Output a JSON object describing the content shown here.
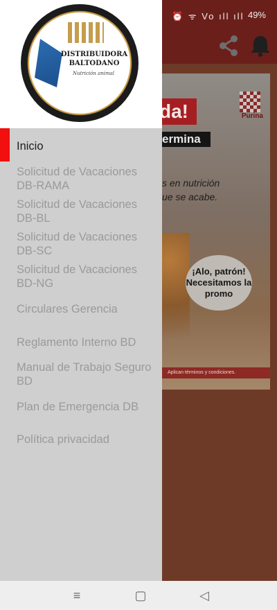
{
  "status_bar": {
    "icons": "⏰ ᯤ Vo ıll ıll",
    "battery": "49%"
  },
  "ad": {
    "headline_fragment": "da!",
    "black_banner": "ermina",
    "brand": "Purina",
    "line1": "s en nutrición",
    "line2": "ue se acabe.",
    "bubble": "¡Alo, patrón! Necesitamos la promo",
    "footer": "Aplican términos y condiciones."
  },
  "logo": {
    "title": "DISTRIBUIDORA BALTODANO",
    "subtitle": "Nutrición animal"
  },
  "menu": {
    "items": [
      {
        "label": "Inicio",
        "active": true
      },
      {
        "label": "Solicitud de Vacaciones DB-RAMA",
        "active": false
      },
      {
        "label": "Solicitud de Vacaciones DB-BL",
        "active": false
      },
      {
        "label": "Solicitud de Vacaciones DB-SC",
        "active": false
      },
      {
        "label": "Solicitud de Vacaciones BD-NG",
        "active": false
      },
      {
        "label": "Circulares Gerencia",
        "active": false
      },
      {
        "label": "Reglamento Interno BD",
        "active": false
      },
      {
        "label": "Manual de Trabajo Seguro BD",
        "active": false
      },
      {
        "label": "Plan de Emergencia DB",
        "active": false
      },
      {
        "label": "Política privacidad",
        "active": false
      }
    ]
  },
  "colors": {
    "accent": "#f10f0f",
    "drawer_bg": "#cfcfcf",
    "appbar": "#6b1f1a"
  }
}
